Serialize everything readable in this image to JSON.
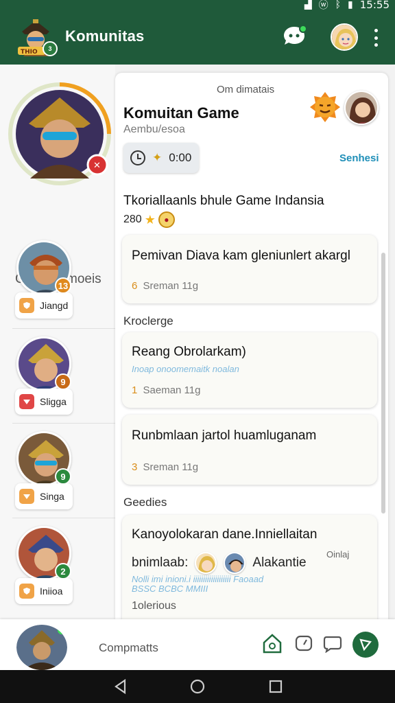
{
  "status_bar": {
    "time": "15:55"
  },
  "app_bar": {
    "title": "Komunitas",
    "logo_badge": "3"
  },
  "sidebar": {
    "profile_name": "Gang Pemoeis",
    "items": [
      {
        "label": "Jiangd",
        "badge": "13",
        "badge_color": "#e08a1e",
        "chip_color": "#f0a347"
      },
      {
        "label": "Sligga",
        "badge": "9",
        "badge_color": "#c86a16",
        "chip_color": "#e04646"
      },
      {
        "label": "Singa",
        "badge": "9",
        "badge_color": "#2b8a3e",
        "chip_color": "#f0a347"
      },
      {
        "label": "Iniioa",
        "badge": "2",
        "badge_color": "#2b8a3e",
        "chip_color": "#f0a347"
      }
    ]
  },
  "panel": {
    "top_label": "Om dimatais",
    "title": "Komuitan Game",
    "subtitle": "Aembu/esoa",
    "timer_value": "0:00",
    "link_label": "Senhesi",
    "section_title": "Tkoriallaanls bhule Game Indansia",
    "rating_value": "280",
    "card1": {
      "title": "Pemivan Diava kam gleniunlert akargl",
      "meta": "Sreman 11g",
      "meta_num": "6"
    },
    "label_kroclerge": "Kroclerge",
    "card2": {
      "title": "Reang Obrolarkam)",
      "blue": "Inoap onoomemaitk noalan",
      "meta": "Saeman 11g",
      "meta_num": "1"
    },
    "card3": {
      "title": "Runbmlaan jartol huamluganam",
      "meta": "Sreman 11g",
      "meta_num": "3"
    },
    "label_geedies": "Geedies",
    "card4": {
      "title": "Kanoyolokaran dane.Inniellaitan",
      "line2_start": "bnimlaab:",
      "line2_end": "Alakantie",
      "side_note": "Oinlaj",
      "blue1": "Nolli       imi     inioni.i     iiiiiiiiiiiiiiiiiii  Faoaad",
      "blue2": "BSSC BCBC MMIII",
      "foot": "1olerious"
    }
  },
  "bottom_bar": {
    "label": "Compmatts"
  },
  "colors": {
    "primary": "#1f5a3a",
    "accent": "#1f8fb8",
    "fab": "#1f6b3d"
  }
}
